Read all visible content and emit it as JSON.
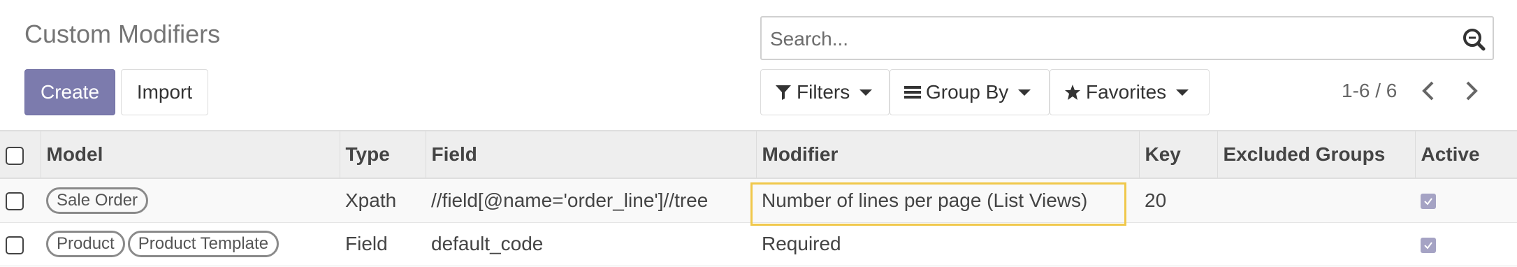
{
  "page": {
    "title": "Custom Modifiers"
  },
  "buttons": {
    "create": "Create",
    "import": "Import"
  },
  "search": {
    "placeholder": "Search..."
  },
  "filters": {
    "filters": "Filters",
    "group_by": "Group By",
    "favorites": "Favorites"
  },
  "pager": {
    "text": "1-6 / 6"
  },
  "table": {
    "columns": [
      "Model",
      "Type",
      "Field",
      "Modifier",
      "Key",
      "Excluded Groups",
      "Active"
    ],
    "rows": [
      {
        "model_tags": [
          "Sale Order"
        ],
        "type": "Xpath",
        "field": "//field[@name='order_line']//tree",
        "modifier": "Number of lines per page (List Views)",
        "key": "20",
        "excluded_groups": "",
        "active": true
      },
      {
        "model_tags": [
          "Product",
          "Product Template"
        ],
        "type": "Field",
        "field": "default_code",
        "modifier": "Required",
        "key": "",
        "excluded_groups": "",
        "active": true
      }
    ]
  },
  "colors": {
    "primary": "#7c7bad",
    "highlight": "#f0c84b",
    "active_checkbox": "#a5a3c4"
  }
}
